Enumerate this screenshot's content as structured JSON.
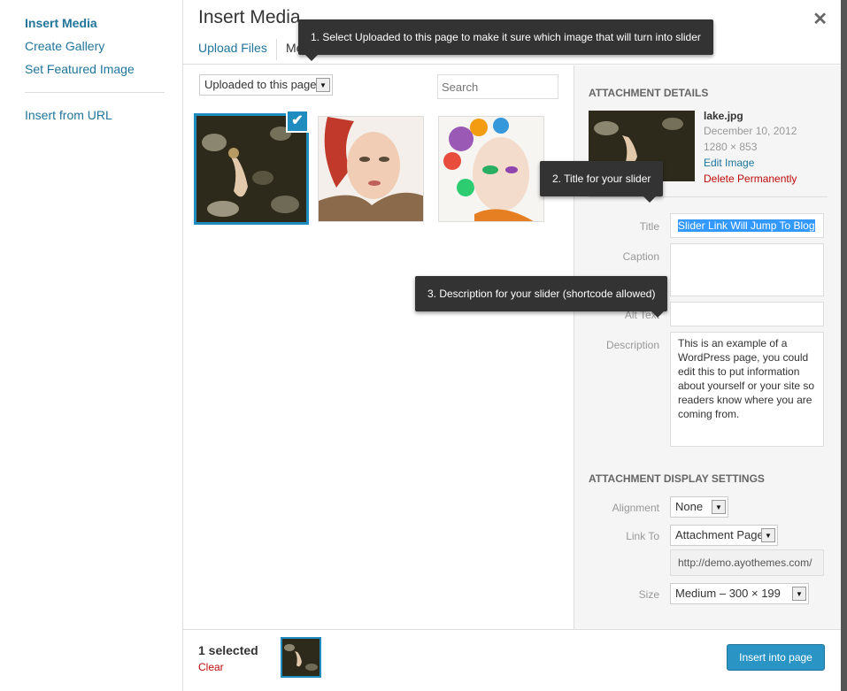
{
  "menu": {
    "active": "Insert Media",
    "items": [
      "Create Gallery",
      "Set Featured Image"
    ],
    "url_item": "Insert from URL"
  },
  "modal": {
    "title": "Insert Media",
    "tabs": [
      "Upload Files",
      "Media Library"
    ]
  },
  "filter": {
    "selected": "Uploaded to this page",
    "search_placeholder": "Search"
  },
  "attachments": [
    {
      "name": "lake.jpg",
      "selected": true
    },
    {
      "name": "portrait-fur",
      "selected": false
    },
    {
      "name": "portrait-flowers",
      "selected": false
    }
  ],
  "details": {
    "heading": "Attachment Details",
    "filename": "lake.jpg",
    "date": "December 10, 2012",
    "dims": "1280 × 853",
    "edit": "Edit Image",
    "delete": "Delete Permanently",
    "labels": {
      "title": "Title",
      "caption": "Caption",
      "alt": "Alt Text",
      "description": "Description"
    },
    "title_value": "Slider Link Will Jump To Blog",
    "description_value": "This is an example of a WordPress page, you could edit this to put information about yourself or your site so readers know where you are coming from."
  },
  "display": {
    "heading": "Attachment Display Settings",
    "alignment_label": "Alignment",
    "alignment": "None",
    "link_label": "Link To",
    "link": "Attachment Page",
    "url": "http://demo.ayothemes.com/",
    "size_label": "Size",
    "size": "Medium – 300 × 199"
  },
  "toolbar": {
    "selected_count": "1 selected",
    "clear": "Clear",
    "insert": "Insert into page"
  },
  "tips": {
    "t1": "1. Select Uploaded to this page to make it sure which image that will turn into slider",
    "t2": "2. Title for your slider",
    "t3": "3. Description for your slider (shortcode allowed)"
  },
  "colors": {
    "accent": "#1e8cbe",
    "link": "#21759b",
    "delete": "#bc0b0b",
    "tooltip": "#333333"
  }
}
